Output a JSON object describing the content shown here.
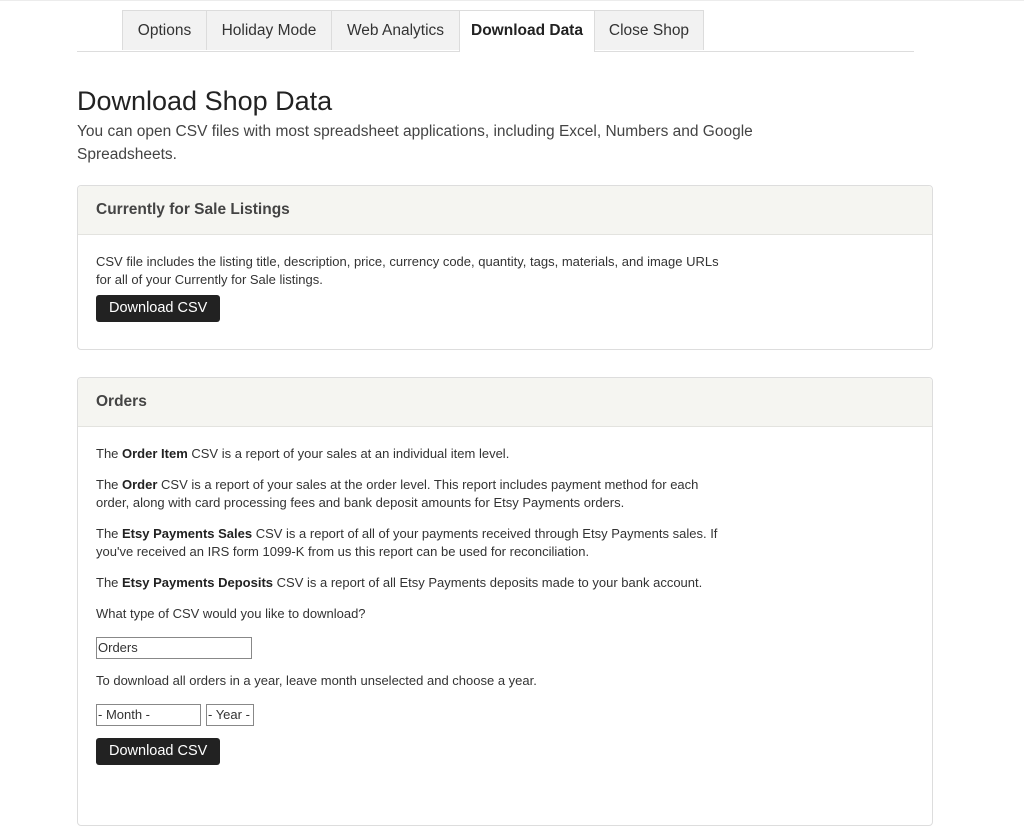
{
  "tabs": [
    {
      "label": "Options",
      "active": false
    },
    {
      "label": "Holiday Mode",
      "active": false
    },
    {
      "label": "Web Analytics",
      "active": false
    },
    {
      "label": "Download Data",
      "active": true
    },
    {
      "label": "Close Shop",
      "active": false
    }
  ],
  "page": {
    "title": "Download Shop Data",
    "subtitle": "You can open CSV files with most spreadsheet applications, including Excel, Numbers and Google Spreadsheets."
  },
  "listings_panel": {
    "title": "Currently for Sale Listings",
    "description": "CSV file includes the listing title, description, price, currency code, quantity, tags, materials, and image URLs for all of your Currently for Sale listings.",
    "button_label": "Download CSV"
  },
  "orders_panel": {
    "title": "Orders",
    "paragraphs": [
      {
        "prefix": "The ",
        "bold": "Order Item",
        "suffix": " CSV is a report of your sales at an individual item level."
      },
      {
        "prefix": "The ",
        "bold": "Order",
        "suffix": " CSV is a report of your sales at the order level. This report includes payment method for each order, along with card processing fees and bank deposit amounts for Etsy Payments orders."
      },
      {
        "prefix": "The ",
        "bold": "Etsy Payments Sales",
        "suffix": " CSV is a report of all of your payments received through Etsy Payments sales. If you've received an IRS form 1099-K from us this report can be used for reconciliation."
      },
      {
        "prefix": "The ",
        "bold": "Etsy Payments Deposits",
        "suffix": " CSV is a report of all Etsy Payments deposits made to your bank account."
      }
    ],
    "csv_type_question": "What type of CSV would you like to download?",
    "csv_type_selected": "Orders",
    "year_hint": "To download all orders in a year, leave month unselected and choose a year.",
    "month_selected": "- Month -",
    "year_selected": "- Year -",
    "button_label": "Download CSV"
  }
}
